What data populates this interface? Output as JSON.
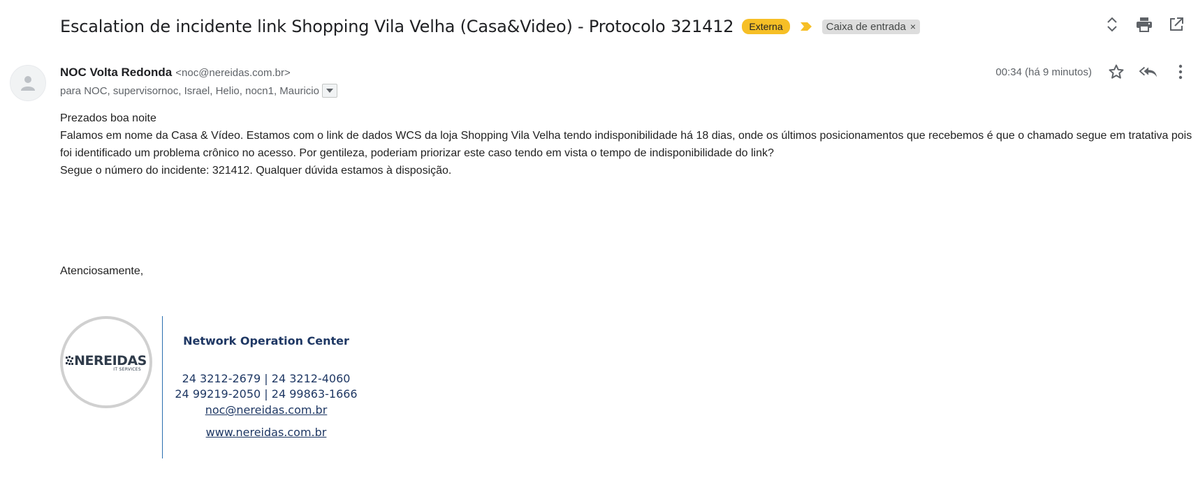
{
  "email": {
    "subject": "Escalation de incidente link Shopping Vila Velha (Casa&Video) - Protocolo 321412",
    "tag_external": "Externa",
    "label_inbox": "Caixa de entrada",
    "label_remove": "×",
    "sender": {
      "name": "NOC Volta Redonda",
      "email": "<noc@nereidas.com.br>"
    },
    "recipients": "para NOC, supervisornoc, Israel, Helio, nocn1, Mauricio",
    "timestamp": "00:34 (há 9 minutos)",
    "body": {
      "greeting": "Prezados boa noite",
      "paragraph1": "Falamos em nome da Casa & Vídeo. Estamos com o link de dados WCS da loja Shopping Vila Velha tendo indisponibilidade há 18 dias, onde os últimos posicionamentos que recebemos é que o chamado segue em tratativa pois foi identificado um problema crônico no acesso. Por gentileza, poderiam priorizar este caso tendo em vista o tempo de indisponibilidade do link?",
      "paragraph2": "Segue o número do incidente:  321412. Qualquer dúvida estamos à disposição.",
      "closing": "Atenciosamente,"
    },
    "signature": {
      "logo_text": "NEREIDAS",
      "logo_subtext": "IT SERVICES",
      "title": "Network Operation Center",
      "phones_line1": "24 3212-2679 | 24 3212-4060",
      "phones_line2": "24 99219-2050 | 24 99863-1666",
      "email": "noc@nereidas.com.br",
      "website": "www.nereidas.com.br"
    }
  },
  "icons": {
    "expand": "expand-collapse-icon",
    "print": "print-icon",
    "open_new_window": "open-in-new-window-icon",
    "star": "star-icon",
    "reply_all": "reply-all-icon",
    "more": "more-vertical-icon",
    "importance": "importance-marker-icon",
    "avatar": "default-avatar-icon"
  },
  "colors": {
    "tag_external_bg": "#f6bf26",
    "importance_marker": "#f6bf26",
    "signature_blue": "#1f3864",
    "divider_blue": "#2a6fb0"
  }
}
